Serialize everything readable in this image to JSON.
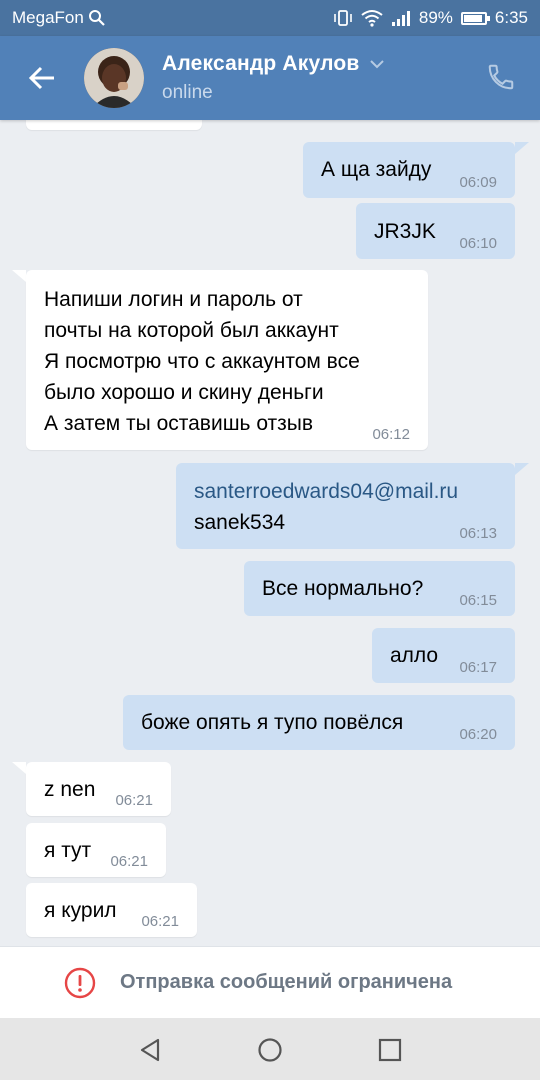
{
  "status_bar": {
    "carrier": "MegaFon",
    "battery": "89%",
    "battery_level": 0.89,
    "time": "6:35"
  },
  "header": {
    "contact_name": "Александр Акулов",
    "status": "online",
    "icons": {
      "back": "arrow-left-icon",
      "dropdown": "chevron-down-icon",
      "call": "phone-icon"
    }
  },
  "messages": [
    {
      "dir": "out",
      "text": "А ща зайду",
      "time": "06:09"
    },
    {
      "dir": "out",
      "text": "JR3JK",
      "time": "06:10"
    },
    {
      "dir": "in",
      "text": "Напиши логин и пароль от\nпочты на которой был аккаунт\nЯ посмотрю что с аккаунтом все\nбыло хорошо и скину деньги\nА затем ты оставишь отзыв",
      "time": "06:12"
    },
    {
      "dir": "out",
      "link": "santerroedwards04@mail.ru",
      "text": "sanek534",
      "time": "06:13"
    },
    {
      "dir": "out",
      "text": "Все нормально?",
      "time": "06:15"
    },
    {
      "dir": "out",
      "text": "алло",
      "time": "06:17"
    },
    {
      "dir": "out",
      "text": "боже опять я тупо повёлся",
      "time": "06:20"
    },
    {
      "dir": "in",
      "text": "z nen",
      "time": "06:21"
    },
    {
      "dir": "in",
      "text": "я тут",
      "time": "06:21"
    },
    {
      "dir": "in",
      "text": "я курил",
      "time": "06:21"
    }
  ],
  "restricted": {
    "label": "Отправка сообщений ограничена",
    "icon": "exclamation-circle-icon"
  },
  "navbar": {
    "icons": [
      "back-triangle-icon",
      "home-circle-icon",
      "recents-square-icon"
    ]
  }
}
